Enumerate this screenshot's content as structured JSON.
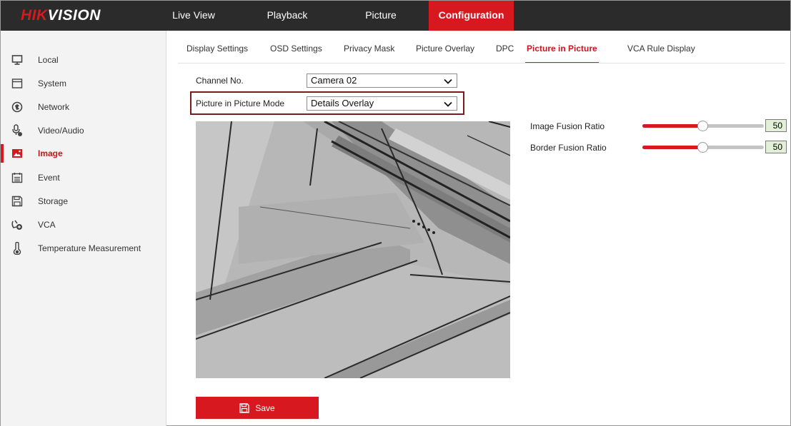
{
  "brand": {
    "logo_accent": "HIK",
    "logo_rest": "VISION"
  },
  "nav": {
    "items": [
      {
        "label": "Live View"
      },
      {
        "label": "Playback"
      },
      {
        "label": "Picture"
      },
      {
        "label": "Configuration",
        "active": true
      }
    ]
  },
  "sidebar": {
    "items": [
      {
        "label": "Local",
        "icon": "monitor-icon"
      },
      {
        "label": "System",
        "icon": "system-icon"
      },
      {
        "label": "Network",
        "icon": "network-icon"
      },
      {
        "label": "Video/Audio",
        "icon": "video-audio-icon"
      },
      {
        "label": "Image",
        "icon": "image-icon",
        "active": true
      },
      {
        "label": "Event",
        "icon": "event-icon"
      },
      {
        "label": "Storage",
        "icon": "storage-icon"
      },
      {
        "label": "VCA",
        "icon": "vca-icon"
      },
      {
        "label": "Temperature Measurement",
        "icon": "thermometer-icon"
      }
    ]
  },
  "tabs": [
    {
      "label": "Display Settings"
    },
    {
      "label": "OSD Settings"
    },
    {
      "label": "Privacy Mask"
    },
    {
      "label": "Picture Overlay"
    },
    {
      "label": "DPC"
    },
    {
      "label": "Picture in Picture",
      "active": true
    },
    {
      "label": "VCA Rule Display"
    }
  ],
  "form": {
    "channel_label": "Channel No.",
    "channel_value": "Camera 02",
    "pip_mode_label": "Picture in Picture Mode",
    "pip_mode_value": "Details Overlay"
  },
  "sliders": {
    "image_fusion": {
      "label": "Image Fusion Ratio",
      "value": "50",
      "fraction": 0.5
    },
    "border_fusion": {
      "label": "Border Fusion Ratio",
      "value": "50",
      "fraction": 0.5
    }
  },
  "save_label": "Save",
  "colors": {
    "accent": "#d7191f",
    "topbar": "#2b2b2b",
    "sidebar": "#f3f3f3"
  }
}
